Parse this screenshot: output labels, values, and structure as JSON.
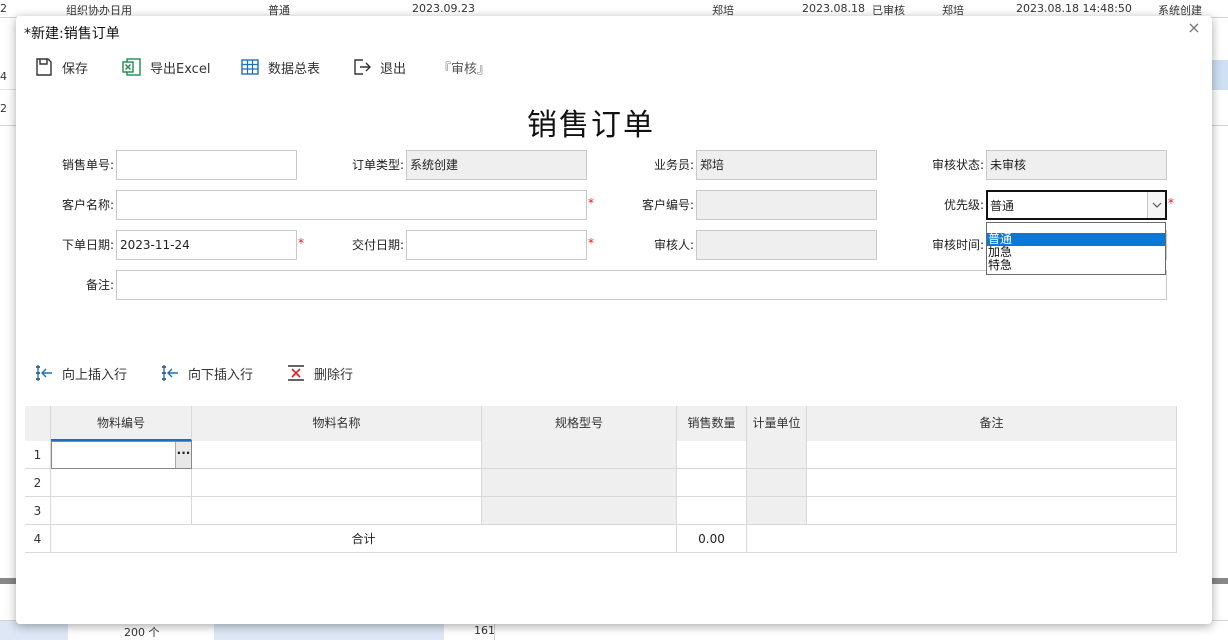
{
  "background": {
    "top_row": {
      "cols": [
        "组织协办日用",
        "普通",
        "2023.09.23",
        "郑培",
        "2023.08.18",
        "已审核",
        "郑培",
        "2023.08.18 14:48:50",
        "系统创建"
      ],
      "rownum": "2"
    },
    "side_rownums": [
      "4",
      "2"
    ],
    "bottom_row": {
      "qty": "200 个",
      "val": "161"
    }
  },
  "dialog": {
    "title": "*新建:销售订单",
    "close_glyph": "×",
    "toolbar": {
      "save": "保存",
      "export": "导出Excel",
      "summary": "数据总表",
      "exit": "退出",
      "audit": "『审核』"
    },
    "form_title": "销售订单",
    "fields": {
      "order_no": {
        "label": "销售单号:",
        "value": ""
      },
      "order_type": {
        "label": "订单类型:",
        "value": "系统创建"
      },
      "salesperson": {
        "label": "业务员:",
        "value": "郑培"
      },
      "audit_status": {
        "label": "审核状态:",
        "value": "未审核"
      },
      "customer_name": {
        "label": "客户名称:",
        "value": ""
      },
      "customer_no": {
        "label": "客户编号:",
        "value": ""
      },
      "priority": {
        "label": "优先级:",
        "value": "普通"
      },
      "order_date": {
        "label": "下单日期:",
        "value": "2023-11-24"
      },
      "delivery_date": {
        "label": "交付日期:",
        "value": ""
      },
      "auditor": {
        "label": "审核人:",
        "value": ""
      },
      "audit_time": {
        "label": "审核时间:",
        "value": ""
      },
      "remark": {
        "label": "备注:",
        "value": ""
      }
    },
    "required_mark": "*",
    "priority_options": [
      "普通",
      "加急",
      "特急"
    ],
    "grid_toolbar": {
      "insert_above": "向上插入行",
      "insert_below": "向下插入行",
      "delete_row": "删除行"
    },
    "grid": {
      "headers": [
        "物料编号",
        "物料名称",
        "规格型号",
        "销售数量",
        "计量单位",
        "备注"
      ],
      "row_numbers": [
        "1",
        "2",
        "3",
        "4"
      ],
      "ellipsis": "···",
      "total_label": "合计",
      "total_qty": "0.00"
    }
  },
  "colors": {
    "accent": "#0a78d7",
    "required": "#e02020",
    "readonly_bg": "#efefef"
  }
}
